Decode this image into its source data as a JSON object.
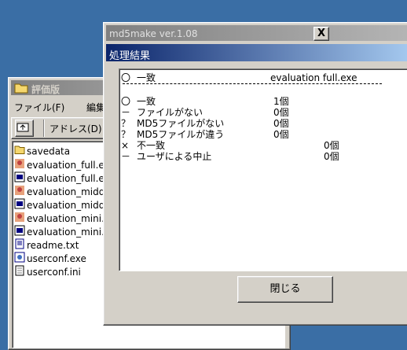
{
  "explorer": {
    "title": "評価版",
    "menu": {
      "file": "ファイル(F)",
      "edit": "編集"
    },
    "toolbar": {
      "address": "アドレス(D)"
    },
    "files": [
      {
        "name": "savedata",
        "icon": "folder-icon"
      },
      {
        "name": "evaluation_full.exe",
        "icon": "app-icon"
      },
      {
        "name": "evaluation_full.exe",
        "icon": "exe-icon"
      },
      {
        "name": "evaluation_middle.exe",
        "icon": "app-icon"
      },
      {
        "name": "evaluation_middle.exe",
        "icon": "exe-icon"
      },
      {
        "name": "evaluation_mini.exe",
        "icon": "app-icon"
      },
      {
        "name": "evaluation_mini.exe",
        "icon": "exe-icon"
      },
      {
        "name": "readme.txt",
        "icon": "text-file-icon"
      },
      {
        "name": "userconf.exe",
        "icon": "config-app-icon"
      },
      {
        "name": "userconf.ini",
        "icon": "ini-file-icon"
      }
    ]
  },
  "md5make": {
    "title": "md5make ver.1.08",
    "close_glyph": "X",
    "header": "処理結果",
    "result": {
      "top_mark": "〇",
      "top_label": "一致",
      "top_file": "evaluation full.exe",
      "rows": [
        {
          "mark": "〇",
          "label": "一致",
          "count": "1個"
        },
        {
          "mark": "－",
          "label": "ファイルがない",
          "count": "0個"
        },
        {
          "mark": "？",
          "label": "MD5ファイルがない",
          "count": "0個"
        },
        {
          "mark": "？",
          "label": "MD5ファイルが違う",
          "count": "0個"
        },
        {
          "mark": "×",
          "label": "不一致",
          "count": "0個"
        },
        {
          "mark": "－",
          "label": "ユーザによる中止",
          "count": "0個"
        }
      ]
    },
    "close_button": "閉じる"
  }
}
